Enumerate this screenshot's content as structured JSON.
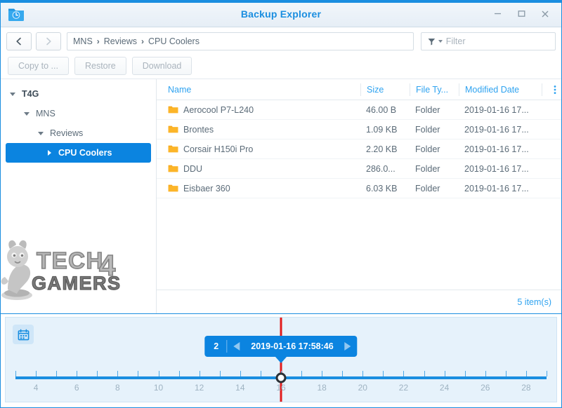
{
  "window": {
    "title": "Backup Explorer",
    "app_icon": "folder-clock-icon",
    "minimize_label": "Minimize",
    "maximize_label": "Maximize",
    "close_label": "Close",
    "accent_color": "#1a8ee0"
  },
  "nav": {
    "back_label": "Back",
    "forward_label": "Forward",
    "breadcrumb": [
      "MNS",
      "Reviews",
      "CPU Coolers"
    ],
    "separator": "›"
  },
  "search": {
    "placeholder": "Filter",
    "value": "",
    "icon": "funnel-icon"
  },
  "toolbar": {
    "buttons": [
      {
        "label": "Copy to ...",
        "enabled": false
      },
      {
        "label": "Restore",
        "enabled": false
      },
      {
        "label": "Download",
        "enabled": false
      }
    ]
  },
  "sidebar": {
    "tree": [
      {
        "label": "T4G",
        "level": 0,
        "expanded": true,
        "selected": false
      },
      {
        "label": "MNS",
        "level": 1,
        "expanded": true,
        "selected": false
      },
      {
        "label": "Reviews",
        "level": 2,
        "expanded": true,
        "selected": false
      },
      {
        "label": "CPU Coolers",
        "level": 3,
        "expanded": false,
        "selected": true
      }
    ],
    "watermark_text_1": "TECH",
    "watermark_text_2": "4",
    "watermark_text_3": "GAMERS"
  },
  "file_list": {
    "columns": [
      "Name",
      "Size",
      "File Ty...",
      "Modified Date"
    ],
    "menu_icon": "kebab-menu-icon",
    "rows": [
      {
        "name": "Aerocool P7-L240",
        "size": "46.00 B",
        "type": "Folder",
        "modified": "2019-01-16 17..."
      },
      {
        "name": "Brontes",
        "size": "1.09 KB",
        "type": "Folder",
        "modified": "2019-01-16 17..."
      },
      {
        "name": "Corsair H150i Pro",
        "size": "2.20 KB",
        "type": "Folder",
        "modified": "2019-01-16 17..."
      },
      {
        "name": "DDU",
        "size": "286.0...",
        "type": "Folder",
        "modified": "2019-01-16 17..."
      },
      {
        "name": "Eisbaer 360",
        "size": "6.03 KB",
        "type": "Folder",
        "modified": "2019-01-16 17..."
      }
    ],
    "status": "5 item(s)"
  },
  "timeline": {
    "calendar_icon": "calendar-icon",
    "version_number": "2",
    "timestamp": "2019-01-16 17:58:46",
    "prev_label": "Previous version",
    "next_label": "Next version",
    "marker_value": 16,
    "axis_min": 3,
    "axis_max": 29,
    "tick_values": [
      3,
      4,
      5,
      6,
      7,
      8,
      9,
      10,
      11,
      12,
      13,
      14,
      15,
      16,
      17,
      18,
      19,
      20,
      21,
      22,
      23,
      24,
      25,
      26,
      27,
      28,
      29
    ],
    "tick_labels": [
      4,
      6,
      8,
      10,
      12,
      14,
      16,
      18,
      20,
      22,
      24,
      26,
      28
    ],
    "playhead_color": "#e21b1b",
    "line_color": "#1a8ee0"
  }
}
